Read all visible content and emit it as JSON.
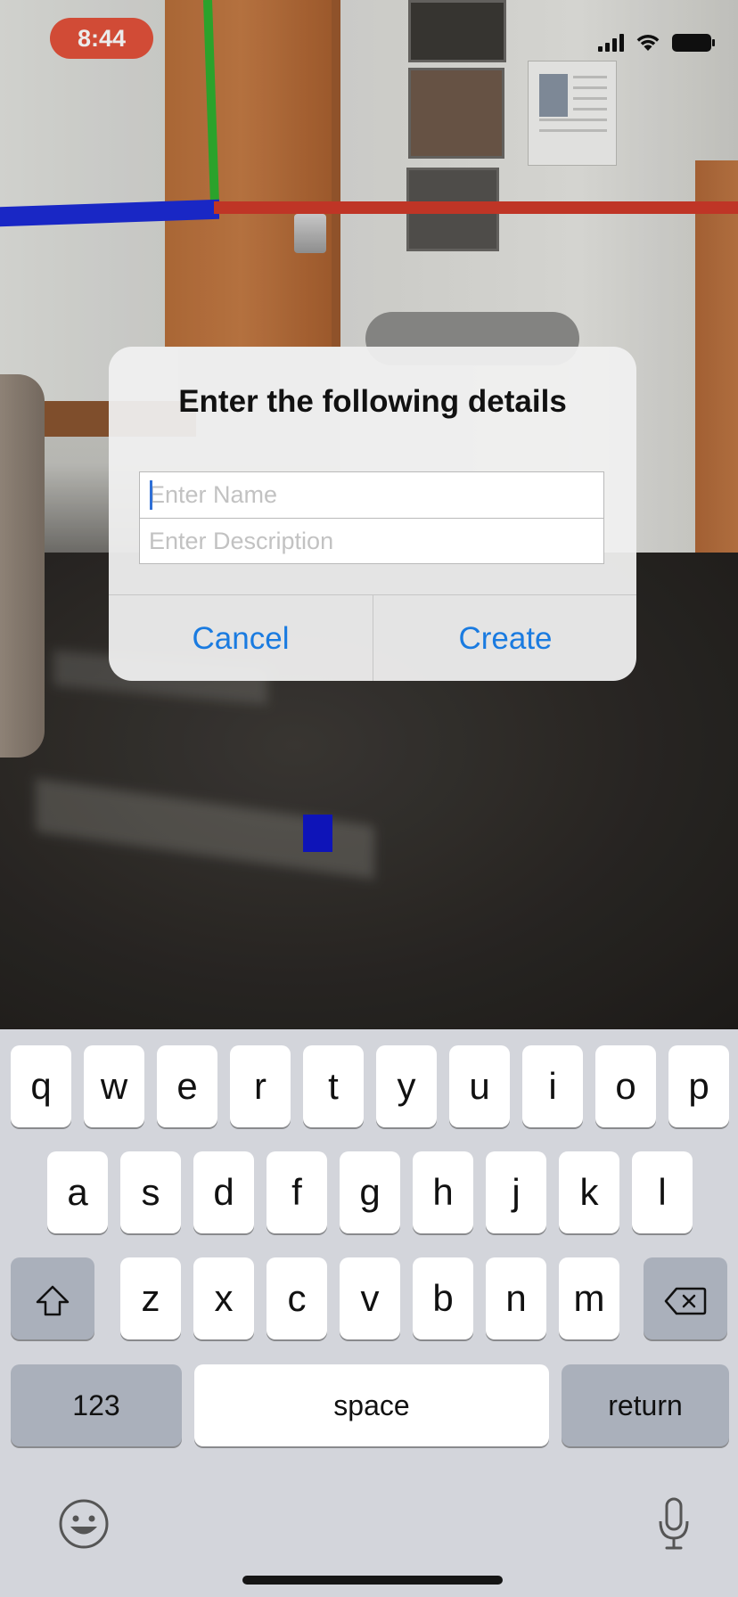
{
  "status_bar": {
    "time": "8:44"
  },
  "alert": {
    "title": "Enter the following details",
    "name_placeholder": "Enter Name",
    "description_placeholder": "Enter Description",
    "cancel_label": "Cancel",
    "create_label": "Create"
  },
  "keyboard": {
    "row1": [
      "q",
      "w",
      "e",
      "r",
      "t",
      "y",
      "u",
      "i",
      "o",
      "p"
    ],
    "row2": [
      "a",
      "s",
      "d",
      "f",
      "g",
      "h",
      "j",
      "k",
      "l"
    ],
    "row3": [
      "z",
      "x",
      "c",
      "v",
      "b",
      "n",
      "m"
    ],
    "numbers_label": "123",
    "space_label": "space",
    "return_label": "return",
    "icons": {
      "shift": "shift-icon",
      "delete": "delete-icon",
      "emoji": "emoji-icon",
      "mic": "microphone-icon"
    }
  },
  "colors": {
    "accent": "#1a7be0",
    "time_pill": "#e3523b",
    "axis_x": "#d03a2a",
    "axis_y": "#2fb02f",
    "axis_z": "#1c2bd6",
    "ar_cube": "#1016c8"
  }
}
